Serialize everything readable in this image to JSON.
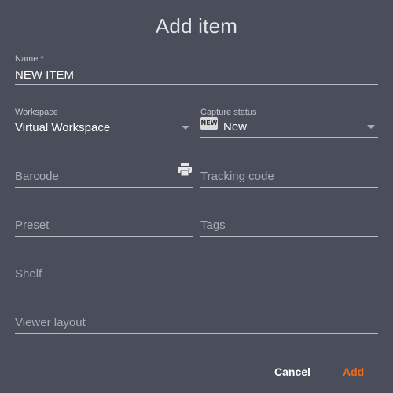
{
  "dialog": {
    "title": "Add item"
  },
  "form": {
    "name": {
      "label": "Name *",
      "value": "NEW ITEM"
    },
    "workspace": {
      "label": "Workspace",
      "value": "Virtual Workspace"
    },
    "capture_status": {
      "label": "Capture status",
      "badge": "NEW",
      "value": "New"
    },
    "barcode": {
      "placeholder": "Barcode",
      "icon": "printer-icon"
    },
    "tracking_code": {
      "placeholder": "Tracking code"
    },
    "preset": {
      "placeholder": "Preset"
    },
    "tags": {
      "placeholder": "Tags"
    },
    "shelf": {
      "placeholder": "Shelf"
    },
    "viewer_layout": {
      "placeholder": "Viewer layout"
    }
  },
  "actions": {
    "cancel_label": "Cancel",
    "add_label": "Add"
  },
  "colors": {
    "background": "#4a4e5a",
    "accent": "#f06a1c",
    "underline": "#b8bbc3"
  }
}
